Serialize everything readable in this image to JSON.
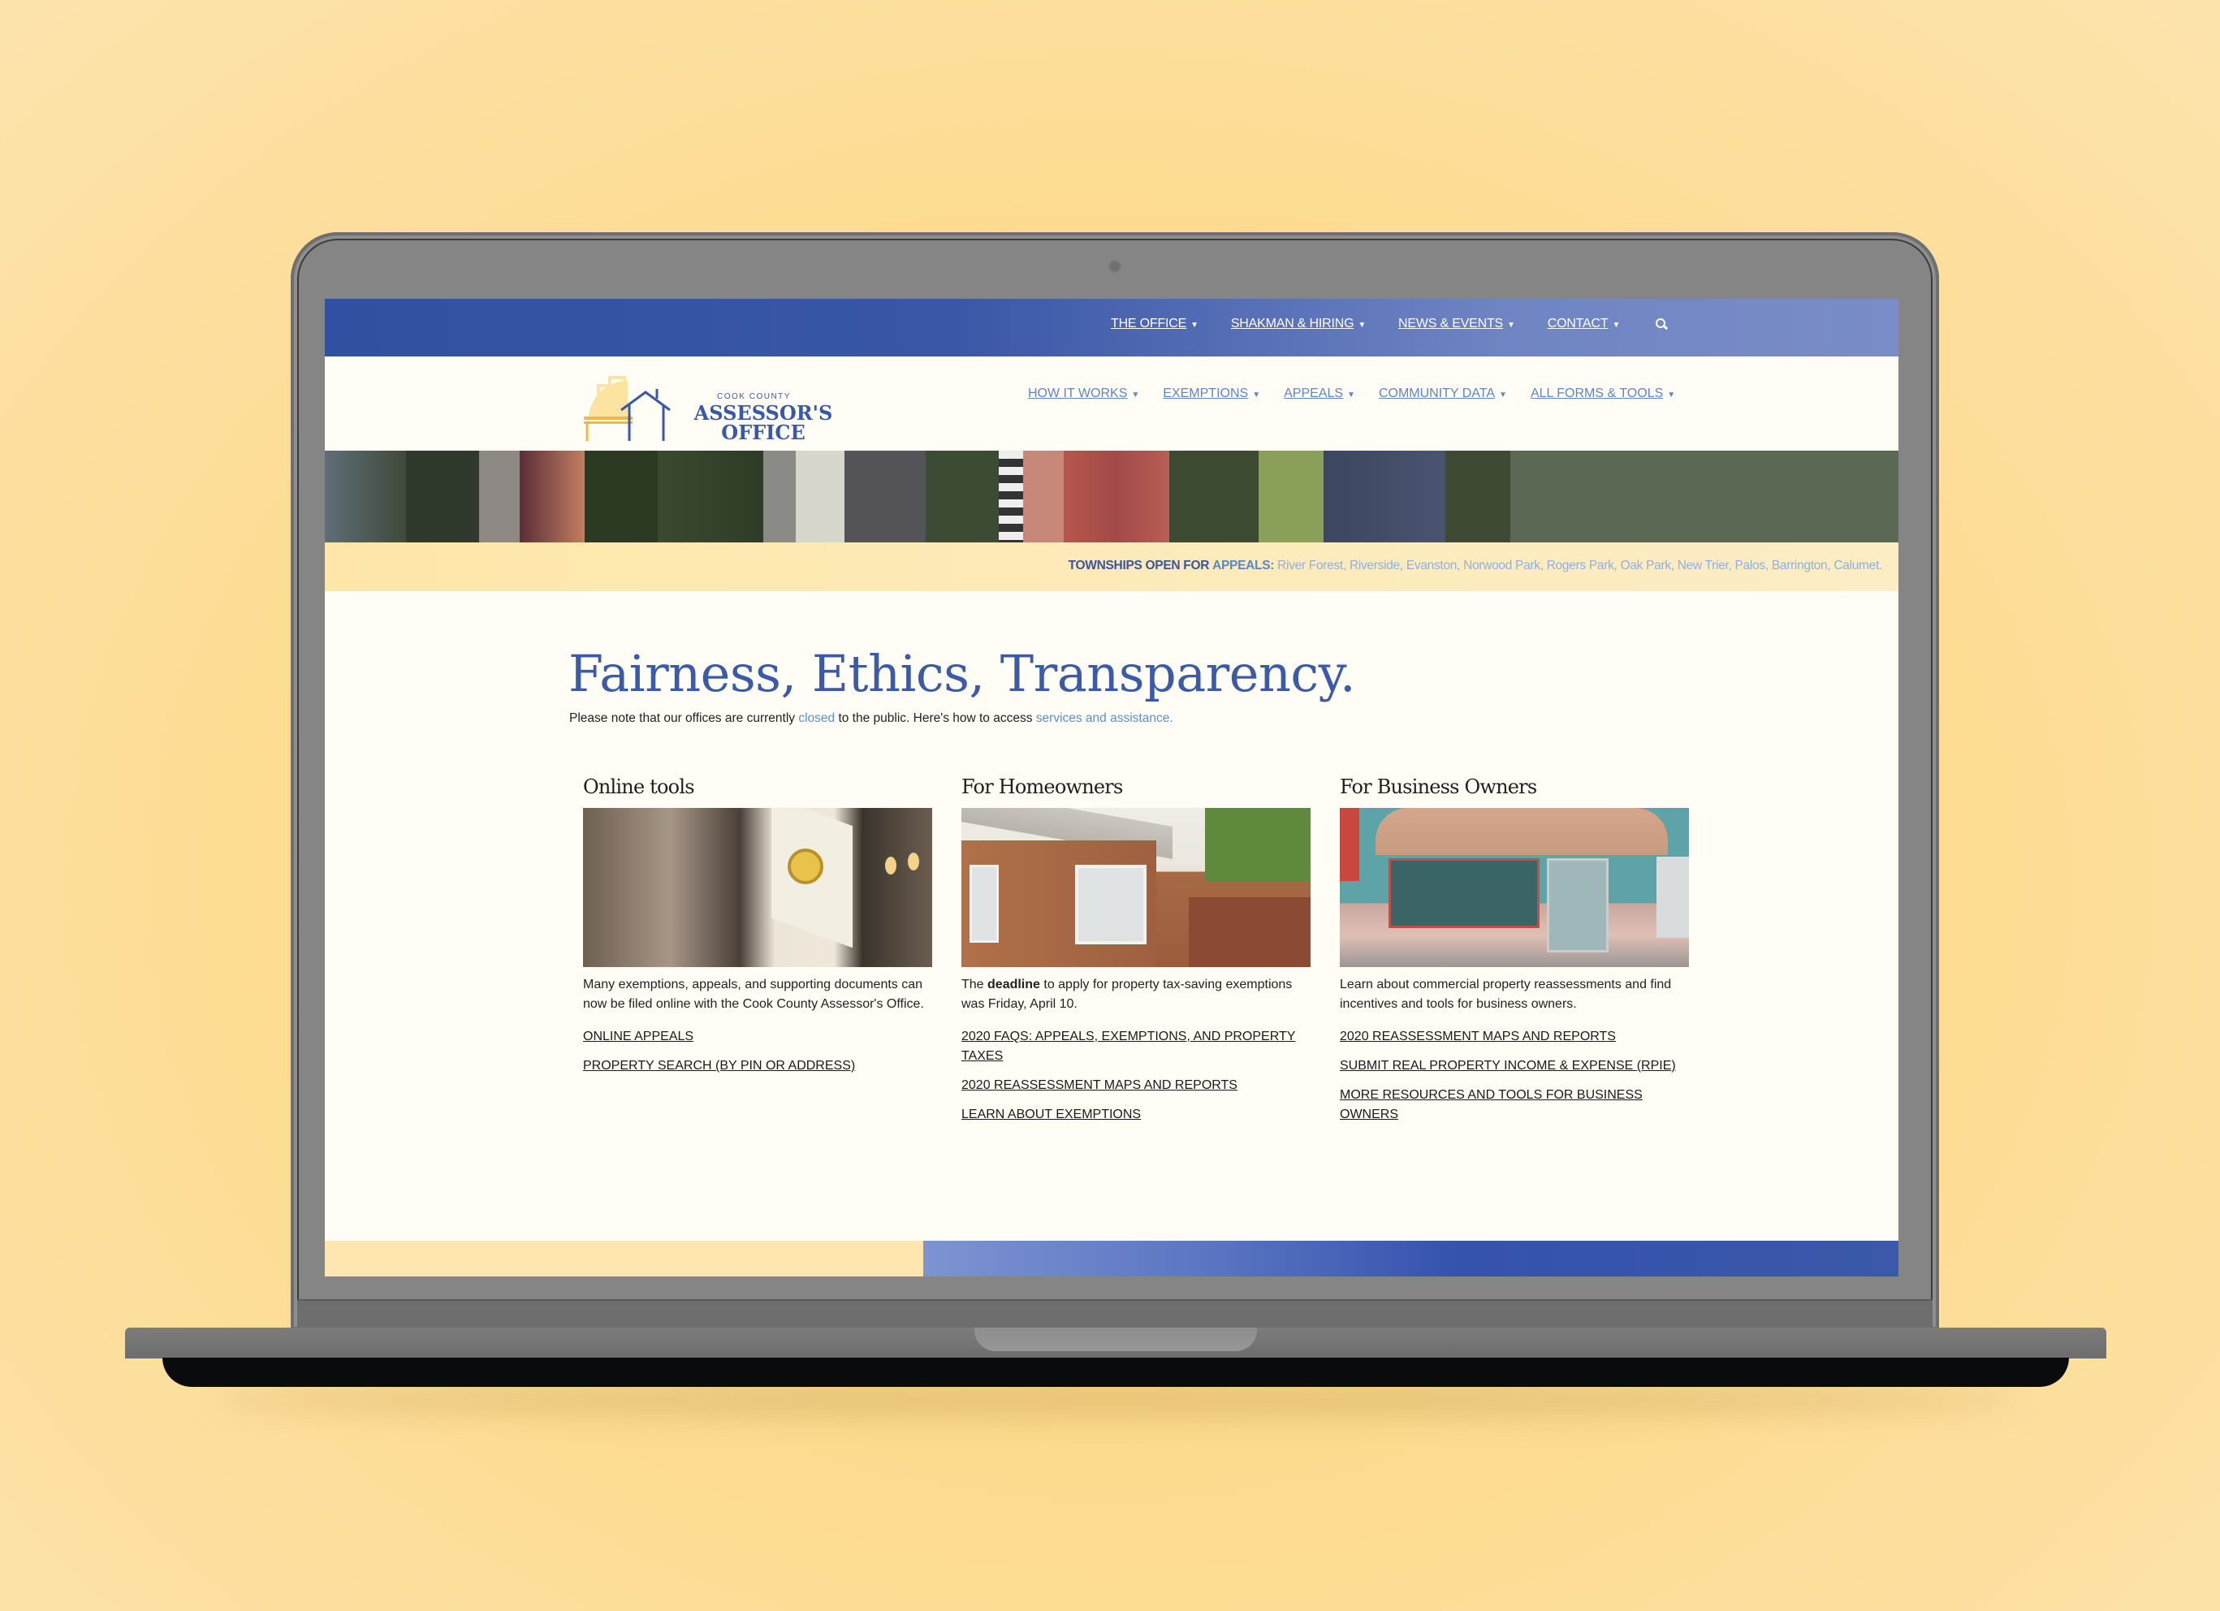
{
  "topnav": {
    "items": [
      {
        "label": "THE OFFICE"
      },
      {
        "label": "SHAKMAN & HIRING"
      },
      {
        "label": "NEWS & EVENTS"
      },
      {
        "label": "CONTACT"
      }
    ],
    "search_icon": "search-icon"
  },
  "logo": {
    "small": "COOK COUNTY",
    "line1": "ASSESSOR'S",
    "line2": "OFFICE"
  },
  "mainnav": {
    "items": [
      {
        "label": "HOW IT WORKS"
      },
      {
        "label": "EXEMPTIONS"
      },
      {
        "label": "APPEALS"
      },
      {
        "label": "COMMUNITY DATA"
      },
      {
        "label": "ALL FORMS & TOOLS"
      }
    ]
  },
  "townships": {
    "label": "TOWNSHIPS OPEN FOR",
    "appeals": "APPEALS:",
    "list": "River Forest, Riverside, Evanston, Norwood Park, Rogers Park, Oak Park, New Trier, Palos, Barrington, Calumet."
  },
  "hero": {
    "title": "Fairness, Ethics, Transparency.",
    "note_1": "Please note that our offices are currently ",
    "note_link_1": "closed",
    "note_2": " to the public. Here's how to access ",
    "note_link_2": "services and assistance."
  },
  "columns": [
    {
      "title": "Online tools",
      "desc": "Many exemptions, appeals, and supporting documents can now be filed online with the Cook County Assessor's Office.",
      "links": [
        "ONLINE APPEALS",
        "PROPERTY SEARCH (BY PIN OR ADDRESS)"
      ]
    },
    {
      "title": "For Homeowners",
      "desc_pre": "The ",
      "desc_bold": "deadline",
      "desc_post": " to apply for property tax-saving exemptions was Friday, April 10.",
      "links": [
        "2020 FAQS: APPEALS, EXEMPTIONS, AND PROPERTY TAXES",
        "2020 REASSESSMENT MAPS AND REPORTS",
        "LEARN ABOUT EXEMPTIONS"
      ]
    },
    {
      "title": "For Business Owners",
      "desc": "Learn about commercial property reassessments and find incentives and tools for business owners.",
      "links": [
        "2020 REASSESSMENT MAPS AND REPORTS",
        "SUBMIT REAL PROPERTY INCOME & EXPENSE (RPIE)",
        "MORE RESOURCES AND TOOLS FOR BUSINESS OWNERS"
      ]
    }
  ],
  "colors": {
    "brand_blue": "#3b5aa8",
    "link_blue": "#5c86c4",
    "accent_yellow": "#fde6a8",
    "background": "#fdd98a"
  }
}
